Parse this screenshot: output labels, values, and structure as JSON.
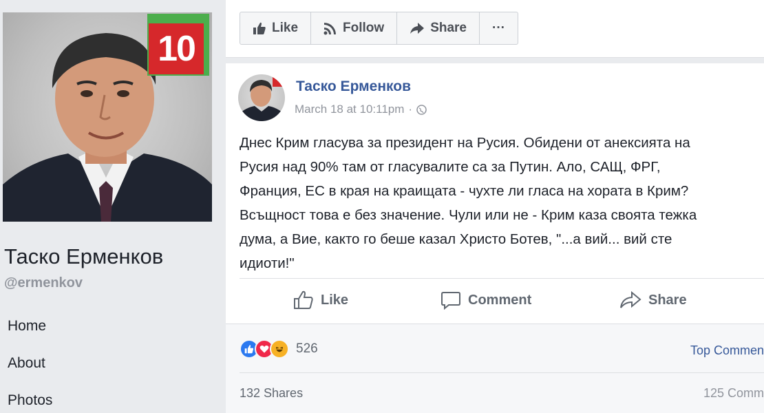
{
  "sidebar": {
    "photo_badge": "10",
    "page_name": "Таско Ерменков",
    "handle": "@ermenkov",
    "nav": [
      "Home",
      "About",
      "Photos"
    ]
  },
  "action_bar": {
    "like_label": "Like",
    "follow_label": "Follow",
    "share_label": "Share",
    "more_label": "···"
  },
  "post": {
    "author": "Таско Ерменков",
    "timestamp": "March 18 at 10:11pm",
    "lines": [
      "Днес Крим гласува за президент на Русия. Обидени от анексията на",
      "Русия над 90% там от гласувалите са за Путин. Ало, САЩ, ФРГ,",
      "Франция, ЕС в края на краищата - чухте ли гласа на хората в Крим?",
      "Всъщност това е без значение. Чули или не - Крим каза своята тежка",
      "дума, а Вие, както го беше казал Христо Ботев, \"...а вий... вий сте",
      "идиоти!\""
    ],
    "actions": {
      "like": "Like",
      "comment": "Comment",
      "share": "Share"
    },
    "reaction_count": "526",
    "top_comments_label": "Top Commen",
    "shares": "132 Shares",
    "comments": "125 Comm"
  },
  "colors": {
    "link_blue": "#365899",
    "like_blue": "#2b79f0",
    "love_red": "#f0284a",
    "haha_yellow": "#f7b125",
    "badge_red": "#d6282b",
    "badge_green": "#4cae4c"
  }
}
